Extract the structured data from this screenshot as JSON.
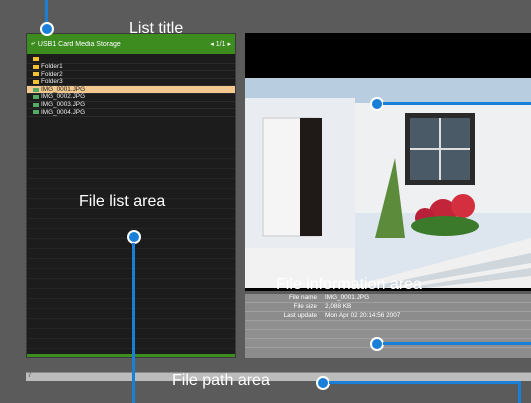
{
  "list": {
    "header_title": "USB1 Card Media Storage",
    "pager": "1/1",
    "items": [
      {
        "label": "",
        "kind": "folder"
      },
      {
        "label": "Folder1",
        "kind": "folder"
      },
      {
        "label": "Folder2",
        "kind": "folder"
      },
      {
        "label": "Folder3",
        "kind": "folder"
      },
      {
        "label": "IMG_0001.JPG",
        "kind": "image",
        "selected": true
      },
      {
        "label": "IMG_0002.JPG",
        "kind": "image"
      },
      {
        "label": "IMG_0003.JPG",
        "kind": "image"
      },
      {
        "label": "IMG_0004.JPG",
        "kind": "image"
      }
    ]
  },
  "info": {
    "rows": [
      {
        "key": "File name",
        "value": "IMG_0001.JPG"
      },
      {
        "key": "File size",
        "value": "2,088 KB"
      },
      {
        "key": "Last update",
        "value": "Mon Apr 02 20:14:56 2007"
      }
    ]
  },
  "path": {
    "text": "/"
  },
  "callouts": {
    "list_title": "List title",
    "file_list_area": "File list area",
    "file_info_area": "File information area",
    "file_path_area": "File path area"
  },
  "colors": {
    "accent": "#1a7fd8",
    "header_green": "#3c8c20",
    "selection": "#f0c890"
  }
}
